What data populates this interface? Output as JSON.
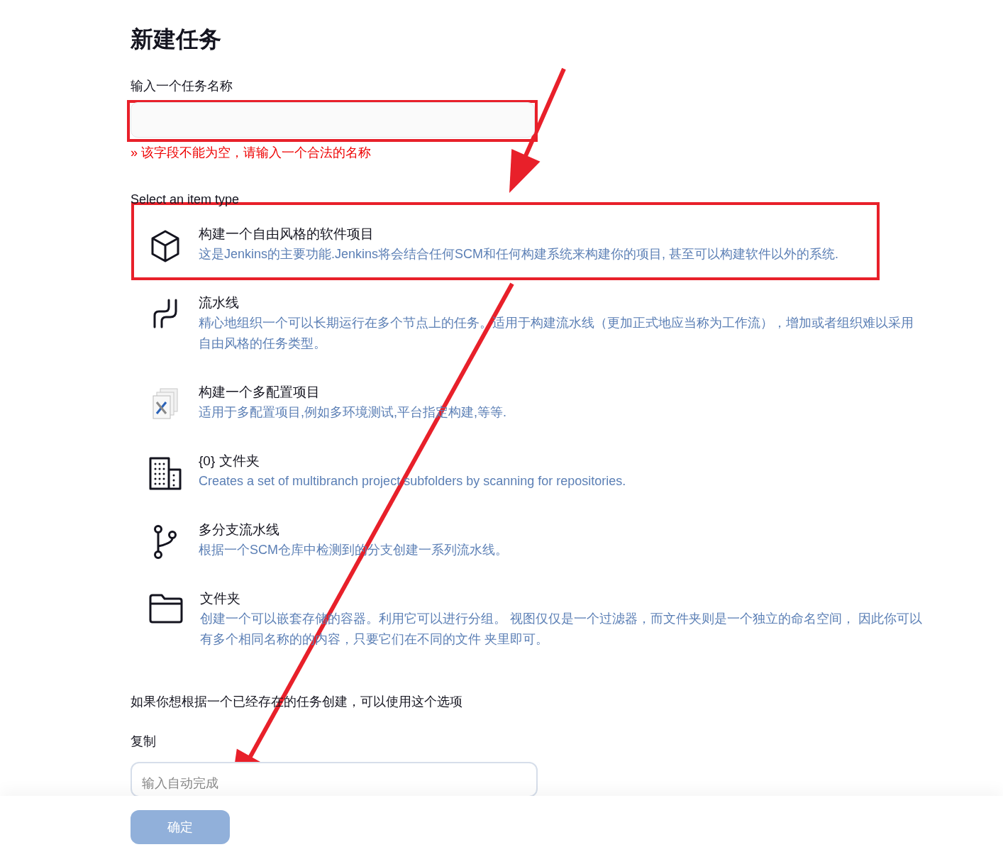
{
  "title": "新建任务",
  "name_field": {
    "label": "输入一个任务名称",
    "error": "» 该字段不能为空，请输入一个合法的名称"
  },
  "item_type_label": "Select an item type",
  "item_types": [
    {
      "kind": "cube",
      "title": "构建一个自由风格的软件项目",
      "description": "这是Jenkins的主要功能.Jenkins将会结合任何SCM和任何构建系统来构建你的项目, 甚至可以构建软件以外的系统."
    },
    {
      "kind": "pipeline",
      "title": "流水线",
      "description": "精心地组织一个可以长期运行在多个节点上的任务。适用于构建流水线（更加正式地应当称为工作流），增加或者组织难以采用自由风格的任务类型。"
    },
    {
      "kind": "multiconfig",
      "title": "构建一个多配置项目",
      "description": "适用于多配置项目,例如多环境测试,平台指定构建,等等."
    },
    {
      "kind": "buildings",
      "title": "{0} 文件夹",
      "description": "Creates a set of multibranch project subfolders by scanning for repositories."
    },
    {
      "kind": "branch",
      "title": "多分支流水线",
      "description": "根据一个SCM仓库中检测到的分支创建一系列流水线。"
    },
    {
      "kind": "folder",
      "title": "文件夹",
      "description": "创建一个可以嵌套存储的容器。利用它可以进行分组。 视图仅仅是一个过滤器，而文件夹则是一个独立的命名空间， 因此你可以有多个相同名称的的内容，只要它们在不同的文件 夹里即可。"
    }
  ],
  "copy_hint": "如果你想根据一个已经存在的任务创建，可以使用这个选项",
  "copy_field": {
    "label": "复制",
    "placeholder": "输入自动完成"
  },
  "ok_button": {
    "label": "确定",
    "disabled": true
  }
}
